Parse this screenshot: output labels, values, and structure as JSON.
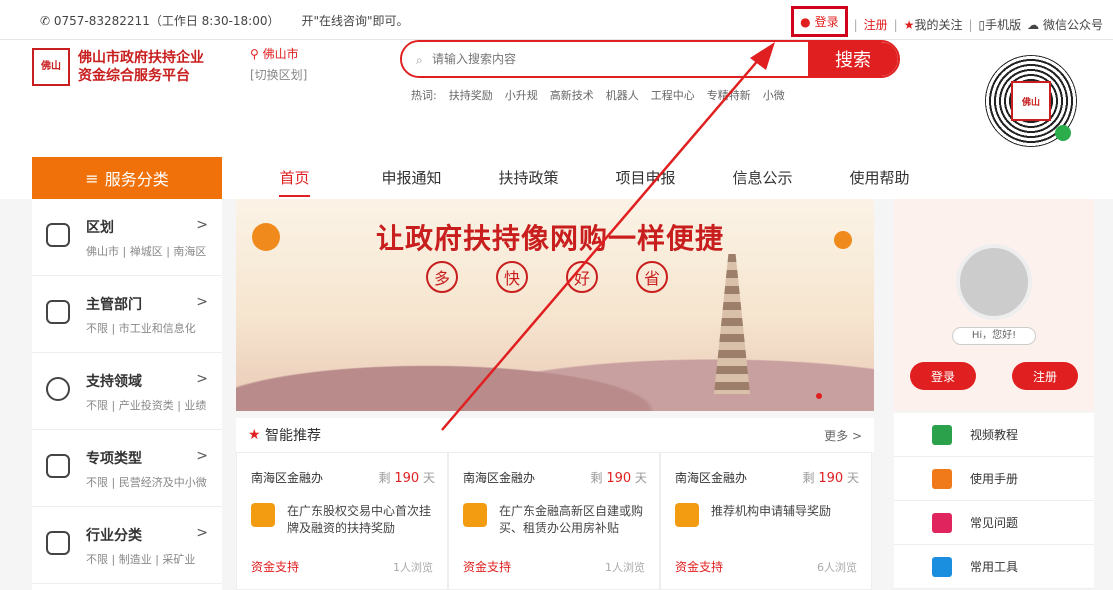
{
  "topbar": {
    "phone": "0757-83282211（工作日 8:30-18:00）",
    "consult": "开\"在线咨询\"即可。",
    "login": "登录",
    "register": "注册",
    "follow": "我的关注",
    "mobile": "手机版",
    "wechat": "微信公众号"
  },
  "logo": {
    "badge": "佛山",
    "line1": "佛山市政府扶持企业",
    "line2": "资金综合服务平台"
  },
  "city": {
    "name": "佛山市",
    "switch": "[切换区划]"
  },
  "search": {
    "placeholder": "请输入搜索内容",
    "button": "搜索"
  },
  "hot": {
    "label": "热词:",
    "words": [
      "扶持奖励",
      "小升规",
      "高新技术",
      "机器人",
      "工程中心",
      "专精特新",
      "小微"
    ]
  },
  "qr": {
    "center": "佛山"
  },
  "nav": {
    "category": "服务分类",
    "items": [
      "首页",
      "申报通知",
      "扶持政策",
      "项目申报",
      "信息公示",
      "使用帮助"
    ]
  },
  "side": [
    {
      "title": "区划",
      "sub": "佛山市 | 禅城区 | 南海区"
    },
    {
      "title": "主管部门",
      "sub": "不限 | 市工业和信息化"
    },
    {
      "title": "支持领域",
      "sub": "不限 | 产业投资类 | 业绩"
    },
    {
      "title": "专项类型",
      "sub": "不限 | 民营经济及中小微"
    },
    {
      "title": "行业分类",
      "sub": "不限 | 制造业 | 采矿业"
    }
  ],
  "banner": {
    "title": "让政府扶持像网购一样便捷",
    "words": [
      "多",
      "快",
      "好",
      "省"
    ]
  },
  "rec": {
    "title": "智能推荐",
    "more": "更多 >"
  },
  "cards": [
    {
      "org": "南海区金融办",
      "days_label": "剩",
      "days": "190",
      "unit": "天",
      "text": "在广东股权交易中心首次挂牌及融资的扶持奖励",
      "tag": "资金支持",
      "views": "1人浏览"
    },
    {
      "org": "南海区金融办",
      "days_label": "剩",
      "days": "190",
      "unit": "天",
      "text": "在广东金融高新区自建或购买、租赁办公用房补贴",
      "tag": "资金支持",
      "views": "1人浏览"
    },
    {
      "org": "南海区金融办",
      "days_label": "剩",
      "days": "190",
      "unit": "天",
      "text": "推荐机构申请辅导奖励",
      "tag": "资金支持",
      "views": "6人浏览"
    }
  ],
  "user": {
    "greeting": "Hi，您好!",
    "login": "登录",
    "register": "注册"
  },
  "links": [
    {
      "label": "视频教程",
      "color": "#2aa14a"
    },
    {
      "label": "使用手册",
      "color": "#f07a1a"
    },
    {
      "label": "常见问题",
      "color": "#e0245e"
    },
    {
      "label": "常用工具",
      "color": "#1a8fe0"
    }
  ]
}
